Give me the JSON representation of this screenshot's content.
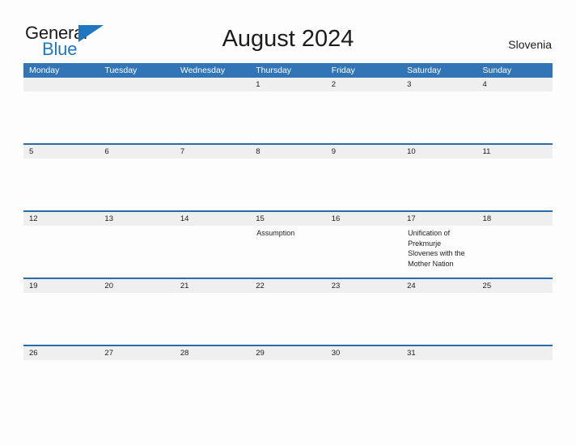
{
  "brand": {
    "word_one": "General",
    "word_two": "Blue",
    "flag_icon": "blue-triangle-flag",
    "colors": {
      "dark_text": "#1a1a1a",
      "brand_blue": "#1f77c2"
    }
  },
  "header": {
    "title": "August 2024",
    "country": "Slovenia"
  },
  "calendar": {
    "colors": {
      "weekday_header_bg": "#3175b6",
      "week_rule": "#2a6ca8",
      "date_band_bg": "#efefef",
      "page_bg": "#fdfdfd",
      "text": "#1c1c1c"
    },
    "weekdays": [
      "Monday",
      "Tuesday",
      "Wednesday",
      "Thursday",
      "Friday",
      "Saturday",
      "Sunday"
    ],
    "weeks": [
      [
        {
          "date": "",
          "event": ""
        },
        {
          "date": "",
          "event": ""
        },
        {
          "date": "",
          "event": ""
        },
        {
          "date": "1",
          "event": ""
        },
        {
          "date": "2",
          "event": ""
        },
        {
          "date": "3",
          "event": ""
        },
        {
          "date": "4",
          "event": ""
        }
      ],
      [
        {
          "date": "5",
          "event": ""
        },
        {
          "date": "6",
          "event": ""
        },
        {
          "date": "7",
          "event": ""
        },
        {
          "date": "8",
          "event": ""
        },
        {
          "date": "9",
          "event": ""
        },
        {
          "date": "10",
          "event": ""
        },
        {
          "date": "11",
          "event": ""
        }
      ],
      [
        {
          "date": "12",
          "event": ""
        },
        {
          "date": "13",
          "event": ""
        },
        {
          "date": "14",
          "event": ""
        },
        {
          "date": "15",
          "event": "Assumption"
        },
        {
          "date": "16",
          "event": ""
        },
        {
          "date": "17",
          "event": "Unification of Prekmurje Slovenes with the Mother Nation"
        },
        {
          "date": "18",
          "event": ""
        }
      ],
      [
        {
          "date": "19",
          "event": ""
        },
        {
          "date": "20",
          "event": ""
        },
        {
          "date": "21",
          "event": ""
        },
        {
          "date": "22",
          "event": ""
        },
        {
          "date": "23",
          "event": ""
        },
        {
          "date": "24",
          "event": ""
        },
        {
          "date": "25",
          "event": ""
        }
      ],
      [
        {
          "date": "26",
          "event": ""
        },
        {
          "date": "27",
          "event": ""
        },
        {
          "date": "28",
          "event": ""
        },
        {
          "date": "29",
          "event": ""
        },
        {
          "date": "30",
          "event": ""
        },
        {
          "date": "31",
          "event": ""
        },
        {
          "date": "",
          "event": ""
        }
      ]
    ]
  }
}
